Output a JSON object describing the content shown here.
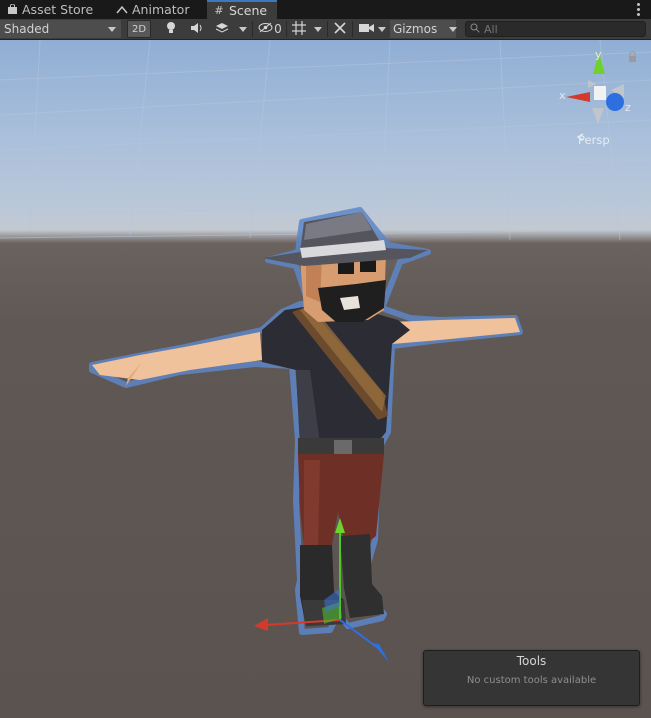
{
  "tabs": [
    {
      "label": "Asset Store",
      "icon": "shopping-bag-icon"
    },
    {
      "label": "Animator",
      "icon": "animator-icon"
    },
    {
      "label": "Scene",
      "icon": "scene-grid-icon",
      "active": true
    }
  ],
  "toolbar": {
    "draw_mode": "Shaded",
    "toggle_2d": "2D",
    "hidden_count": "0",
    "gizmos_label": "Gizmos",
    "search_placeholder": "All"
  },
  "orientation_gizmo": {
    "x_label": "x",
    "y_label": "y",
    "z_label": "z",
    "projection_label": "Persp"
  },
  "tools_overlay": {
    "title": "Tools",
    "message": "No custom tools available"
  },
  "colors": {
    "panel_bg": "#3c3c3c",
    "tab_bar_bg": "#191919",
    "active_tab_accent": "#3a79bb",
    "axis_x": "#d43a2c",
    "axis_y": "#6fd12b",
    "axis_z": "#2e6fe0"
  }
}
